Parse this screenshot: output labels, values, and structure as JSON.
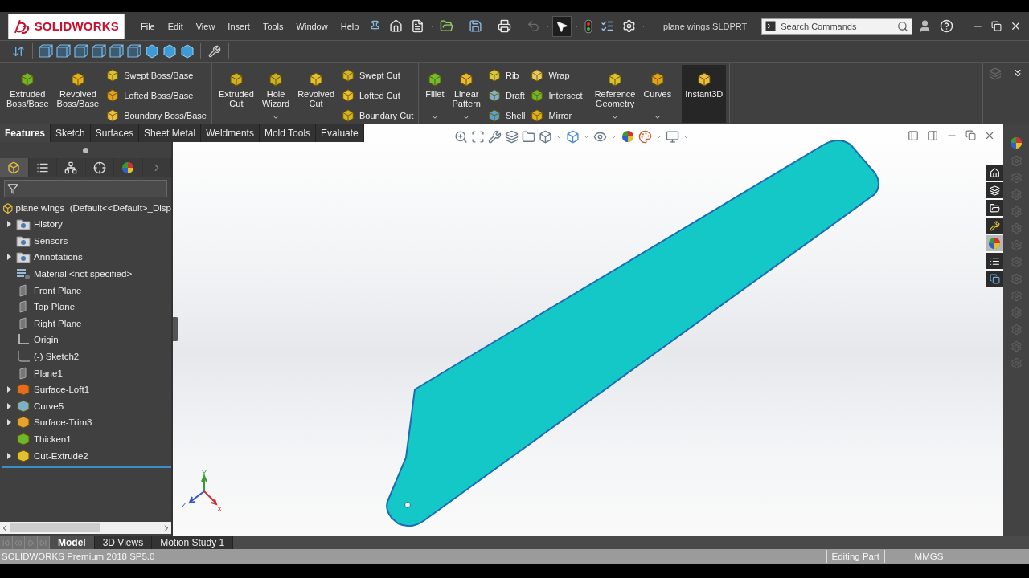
{
  "app": {
    "logo": "SOLIDWORKS",
    "document_title": "plane wings.SLDPRT"
  },
  "menu": [
    {
      "label": "File"
    },
    {
      "label": "Edit"
    },
    {
      "label": "View"
    },
    {
      "label": "Insert"
    },
    {
      "label": "Tools"
    },
    {
      "label": "Window"
    },
    {
      "label": "Help"
    }
  ],
  "search": {
    "placeholder": "Search Commands"
  },
  "ribbon": [
    {
      "items": [
        {
          "kind": "large",
          "label": "Extruded Boss/Base",
          "dropdown": false,
          "on": false
        },
        {
          "kind": "large",
          "label": "Revolved Boss/Base",
          "dropdown": false,
          "on": false
        },
        {
          "kind": "stack",
          "entries": [
            "Swept Boss/Base",
            "Lofted Boss/Base",
            "Boundary Boss/Base"
          ]
        }
      ]
    },
    {
      "items": [
        {
          "kind": "large",
          "label": "Extruded Cut",
          "dropdown": false,
          "on": false
        },
        {
          "kind": "large",
          "label": "Hole Wizard",
          "dropdown": true,
          "on": false
        },
        {
          "kind": "large",
          "label": "Revolved Cut",
          "dropdown": false,
          "on": false
        },
        {
          "kind": "stack",
          "entries": [
            "Swept Cut",
            "Lofted Cut",
            "Boundary Cut"
          ]
        }
      ]
    },
    {
      "items": [
        {
          "kind": "large",
          "label": "Fillet",
          "dropdown": true,
          "on": false
        },
        {
          "kind": "large",
          "label": "Linear Pattern",
          "dropdown": true,
          "on": false
        },
        {
          "kind": "stack",
          "entries": [
            "Rib",
            "Draft",
            "Shell"
          ]
        },
        {
          "kind": "stack",
          "entries": [
            "Wrap",
            "Intersect",
            "Mirror"
          ]
        }
      ]
    },
    {
      "items": [
        {
          "kind": "large",
          "label": "Reference Geometry",
          "dropdown": true,
          "on": false
        },
        {
          "kind": "large",
          "label": "Curves",
          "dropdown": true,
          "on": false
        }
      ]
    },
    {
      "items": [
        {
          "kind": "large",
          "label": "Instant3D",
          "dropdown": false,
          "on": true
        }
      ]
    }
  ],
  "command_tabs": [
    {
      "label": "Features",
      "selected": true
    },
    {
      "label": "Sketch",
      "selected": false
    },
    {
      "label": "Surfaces",
      "selected": false
    },
    {
      "label": "Sheet Metal",
      "selected": false
    },
    {
      "label": "Weldments",
      "selected": false
    },
    {
      "label": "Mold Tools",
      "selected": false
    },
    {
      "label": "Evaluate",
      "selected": false
    }
  ],
  "feature_tree": {
    "root": "plane wings  (Default<<Default>_Disp",
    "items": [
      {
        "label": "History",
        "expandable": true
      },
      {
        "label": "Sensors",
        "expandable": false
      },
      {
        "label": "Annotations",
        "expandable": true
      },
      {
        "label": "Material <not specified>",
        "expandable": false
      },
      {
        "label": "Front Plane",
        "expandable": false
      },
      {
        "label": "Top Plane",
        "expandable": false
      },
      {
        "label": "Right Plane",
        "expandable": false
      },
      {
        "label": "Origin",
        "expandable": false
      },
      {
        "label": "(-) Sketch2",
        "expandable": false
      },
      {
        "label": "Plane1",
        "expandable": false
      },
      {
        "label": "Surface-Loft1",
        "expandable": true
      },
      {
        "label": "Curve5",
        "expandable": true
      },
      {
        "label": "Surface-Trim3",
        "expandable": true
      },
      {
        "label": "Thicken1",
        "expandable": false
      },
      {
        "label": "Cut-Extrude2",
        "expandable": true
      }
    ]
  },
  "viewport": {
    "triad": [
      "Y",
      "Z",
      "X"
    ]
  },
  "bottom_tabs": [
    {
      "label": "Model",
      "selected": true
    },
    {
      "label": "3D Views",
      "selected": false
    },
    {
      "label": "Motion Study 1",
      "selected": false
    }
  ],
  "status_bar": {
    "product": "SOLIDWORKS Premium 2018 SP5.0",
    "mode": "Editing Part",
    "units": "MMGS"
  }
}
